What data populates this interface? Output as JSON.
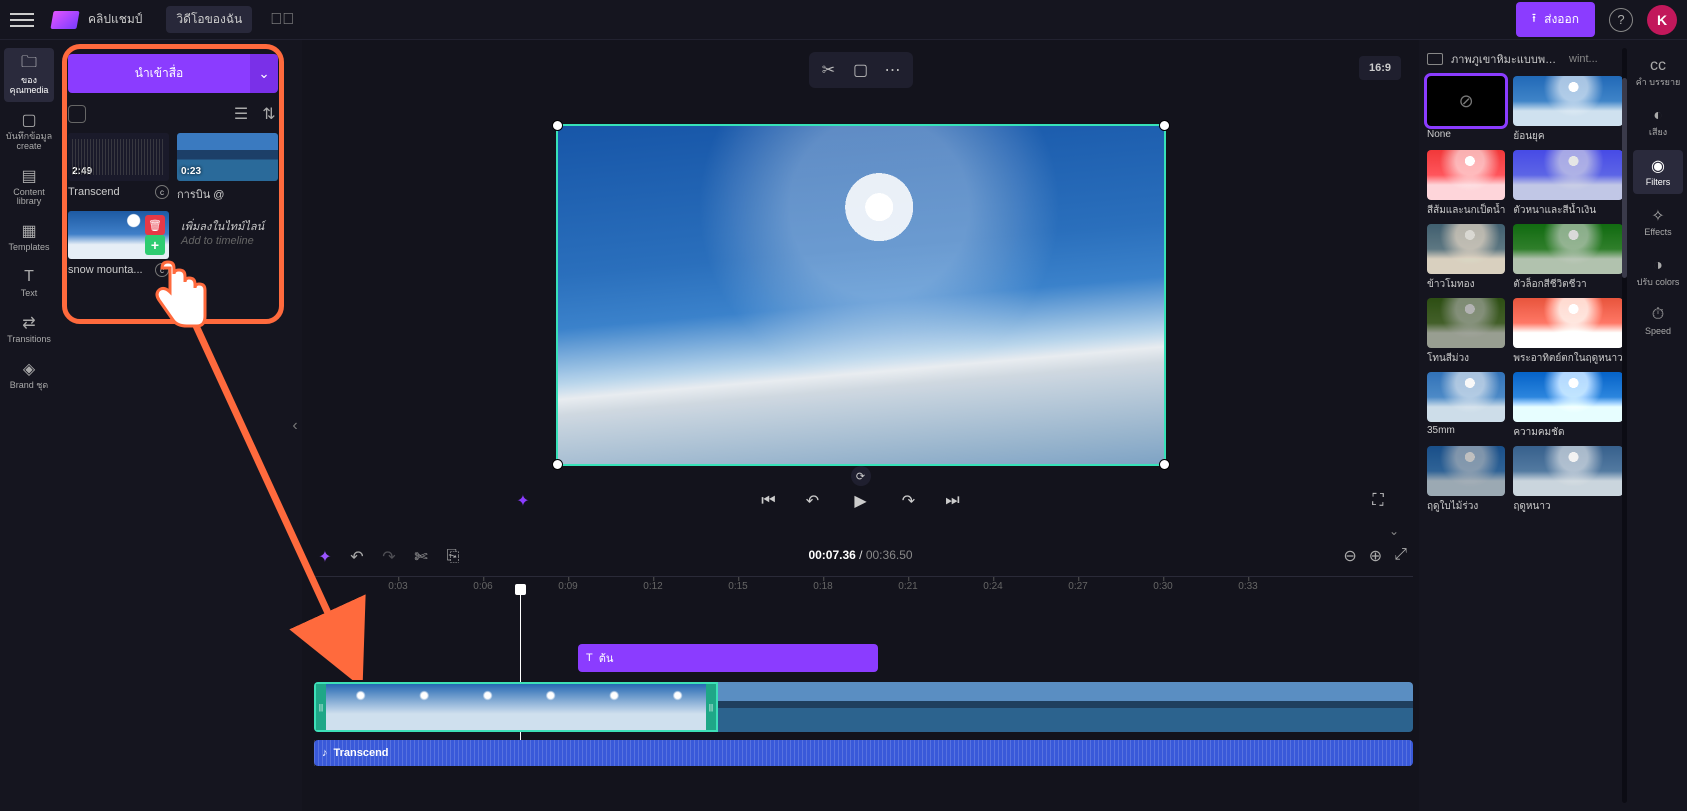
{
  "top": {
    "project_name": "คลิปแชมป์",
    "tab_my_videos": "วิดีโอของฉัน",
    "export_label": "ส่งออก",
    "avatar_initial": "K"
  },
  "left_rail": {
    "media": "ของคุณmedia",
    "record": "บันทึกข้อมูล create",
    "content": "Content library",
    "templates": "Templates",
    "text": "Text",
    "transitions": "Transitions",
    "brand": "Brand ชุด"
  },
  "media_panel": {
    "import_label": "นำเข้าสื่อ",
    "items": [
      {
        "duration": "2:49",
        "label": "Transcend"
      },
      {
        "duration": "0:23",
        "label": "การบิน @"
      },
      {
        "label": "snow mounta..."
      }
    ],
    "tooltip_line1": "เพิ่มลงในไทม์ไลน์",
    "tooltip_line2": "Add to timeline"
  },
  "preview": {
    "aspect": "16:9"
  },
  "timeline": {
    "current": "00:07.36",
    "total": "00:36.50",
    "ticks": [
      "0:03",
      "0:06",
      "0:09",
      "0:12",
      "0:15",
      "0:18",
      "0:21",
      "0:24",
      "0:27",
      "0:30",
      "0:33"
    ],
    "text_clip_label": "ต้น",
    "audio_clip_label": "Transcend"
  },
  "right_panel": {
    "breadcrumb1": "ภาพภูเขาหิมะแบบพาโนรามา",
    "breadcrumb2": "wint...",
    "filters": [
      "None",
      "ย้อนยุค",
      "สีส้มและนกเป็ดน้ำ",
      "ตัวหนาและสีน้ำเงิน",
      "ข้าวโมทอง",
      "ตัวล็อกสีชีวิตชีวา",
      "โทนสีม่วง",
      "พระอาทิตย์ตกในฤดูหนาว",
      "35mm",
      "ความคมชัด",
      "ฤดูใบไม้ร่วง",
      "ฤดูหนาว"
    ]
  },
  "right_rail": {
    "captions": "คำ บรรยาย",
    "audio": "เสียง",
    "filters": "Filters",
    "effects": "Effects",
    "adjust": "ปรับ colors",
    "speed": "Speed"
  }
}
